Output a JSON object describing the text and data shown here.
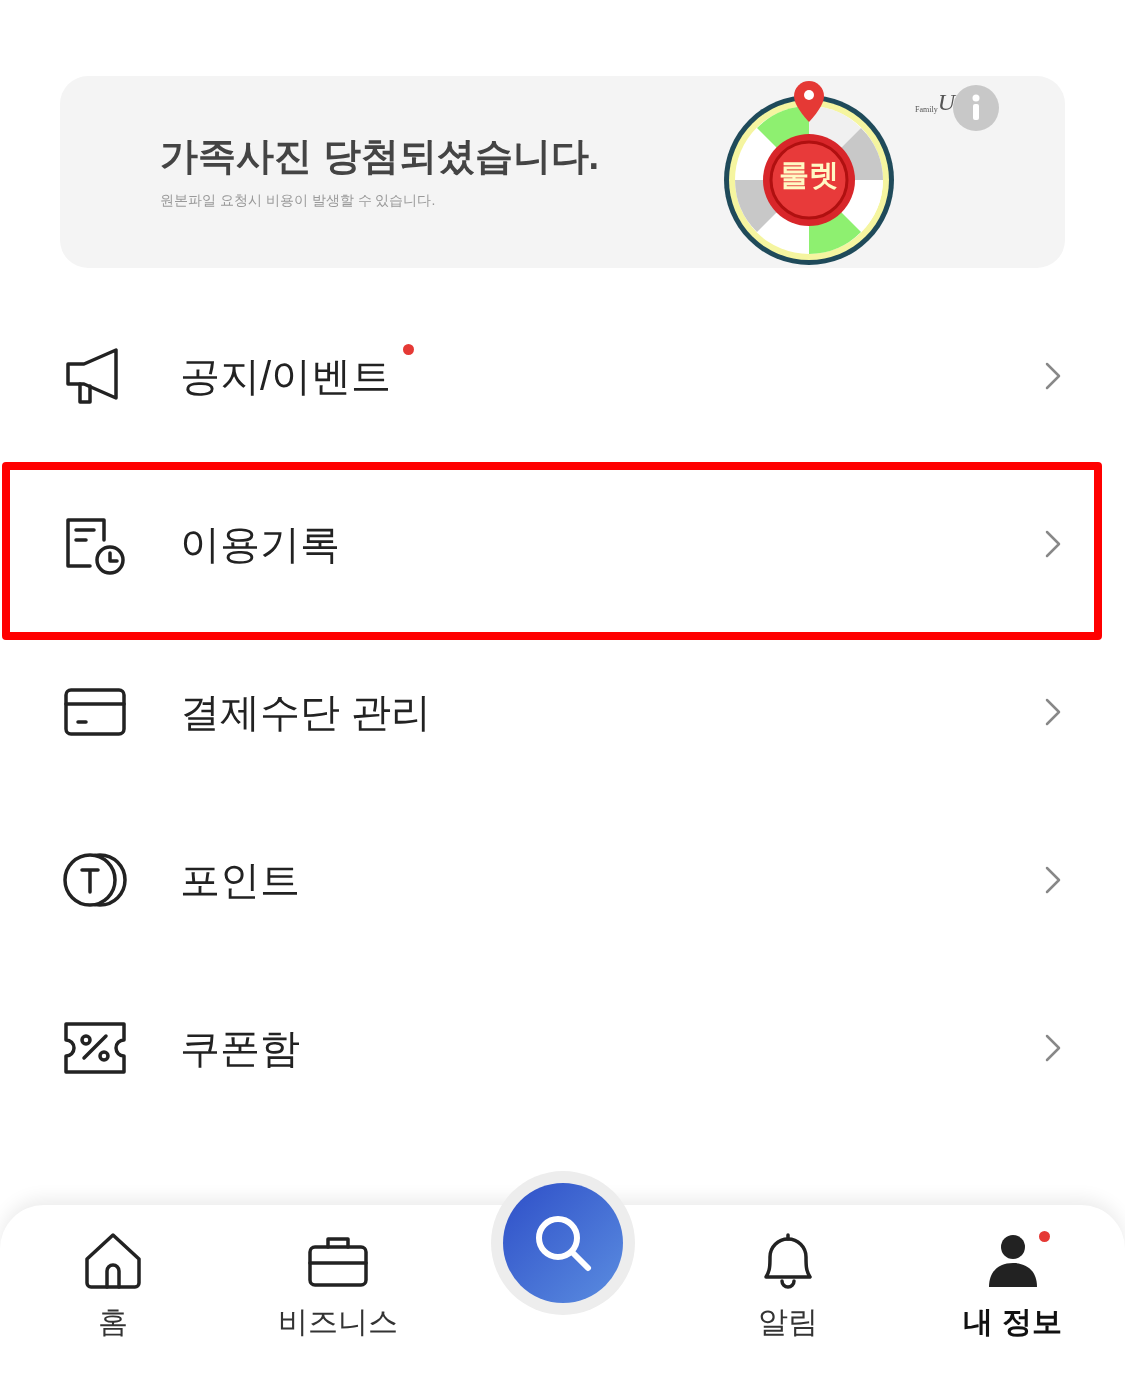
{
  "banner": {
    "title": "가족사진 당첨되셨습니다.",
    "subtitle": "원본파일 요청시 비용이 발생할 수 있습니다.",
    "roulette_label": "룰렛",
    "logo_text": "Family",
    "logo_mark": "U"
  },
  "menu": [
    {
      "kind": "megaphone",
      "label": "공지/이벤트",
      "new_dot": true,
      "highlighted": false
    },
    {
      "kind": "history",
      "label": "이용기록",
      "new_dot": false,
      "highlighted": true
    },
    {
      "kind": "card",
      "label": "결제수단 관리",
      "new_dot": false,
      "highlighted": false
    },
    {
      "kind": "points",
      "label": "포인트",
      "new_dot": false,
      "highlighted": false
    },
    {
      "kind": "coupon",
      "label": "쿠폰함",
      "new_dot": false,
      "highlighted": false
    }
  ],
  "bottom_nav": [
    {
      "kind": "home",
      "label": "홈",
      "selected": false,
      "new_dot": false
    },
    {
      "kind": "business",
      "label": "비즈니스",
      "selected": false,
      "new_dot": false
    },
    {
      "kind": "search",
      "selected": false
    },
    {
      "kind": "bell",
      "label": "알림",
      "selected": false,
      "new_dot": false
    },
    {
      "kind": "profile",
      "label": "내 정보",
      "selected": true,
      "new_dot": true
    }
  ]
}
